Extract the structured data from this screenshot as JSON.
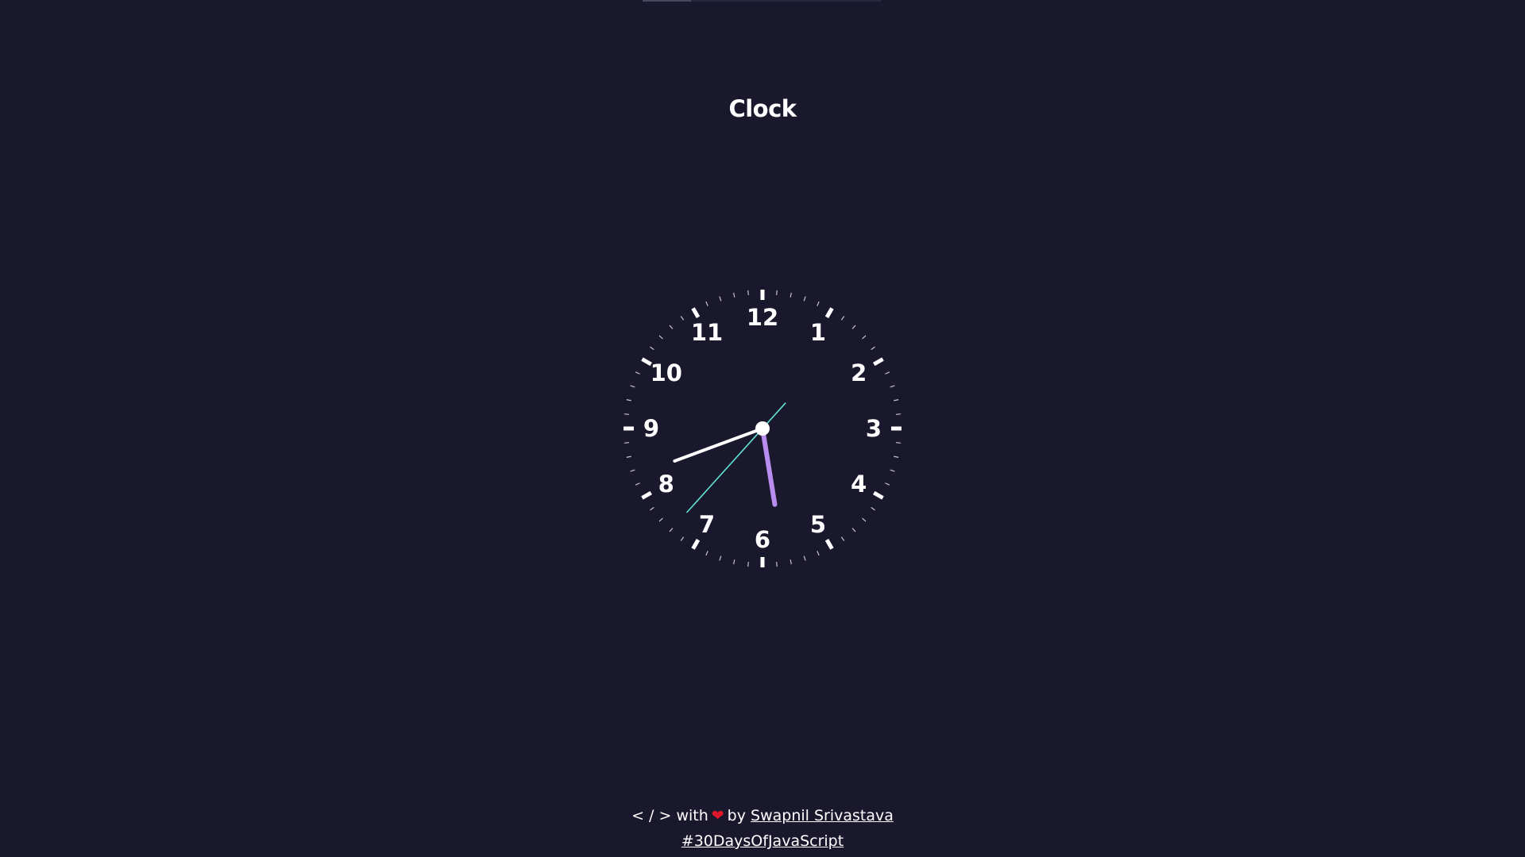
{
  "title": "Clock",
  "clock": {
    "numerals": [
      "12",
      "1",
      "2",
      "3",
      "4",
      "5",
      "6",
      "7",
      "8",
      "9",
      "10",
      "11"
    ],
    "time": {
      "hours": 5,
      "minutes": 41,
      "seconds": 37
    },
    "colors": {
      "face_marks": "#ffffff",
      "hour_hand": "#b98cf0",
      "minute_hand": "#ffffff",
      "second_hand": "#5fe3d8",
      "center": "#ffffff"
    }
  },
  "footer": {
    "code_symbol": "< / > with",
    "heart_icon": "❤",
    "by_text": "by",
    "author": "Swapnil Srivastava",
    "hashtag": "#30DaysOfJavaScript"
  },
  "colors": {
    "background": "#1a182d",
    "heart": "#e0162b"
  }
}
